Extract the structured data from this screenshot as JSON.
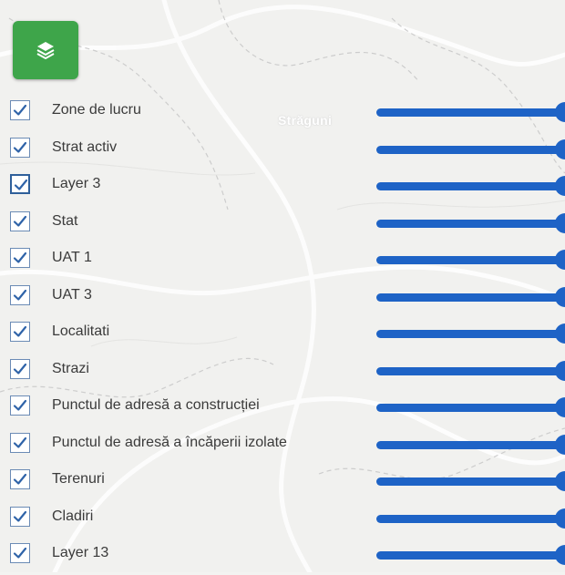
{
  "map": {
    "place_label": "Străguni"
  },
  "layers_button": {
    "icon": "layers-icon",
    "color": "#3ea54a"
  },
  "accent_color": "#1e63c6",
  "layers": [
    {
      "label": "Zone de lucru",
      "checked": true,
      "opacity": 1.0
    },
    {
      "label": "Strat activ",
      "checked": true,
      "opacity": 1.0
    },
    {
      "label": "Layer 3",
      "checked": true,
      "opacity": 1.0,
      "focused": true
    },
    {
      "label": "Stat",
      "checked": true,
      "opacity": 1.0
    },
    {
      "label": "UAT 1",
      "checked": true,
      "opacity": 1.0
    },
    {
      "label": "UAT 3",
      "checked": true,
      "opacity": 1.0
    },
    {
      "label": "Localitati",
      "checked": true,
      "opacity": 1.0
    },
    {
      "label": "Strazi",
      "checked": true,
      "opacity": 1.0
    },
    {
      "label": "Punctul de adresă a construcției",
      "checked": true,
      "opacity": 1.0
    },
    {
      "label": "Punctul de adresă a încăperii izolate",
      "checked": true,
      "opacity": 1.0
    },
    {
      "label": "Terenuri",
      "checked": true,
      "opacity": 1.0
    },
    {
      "label": "Cladiri",
      "checked": true,
      "opacity": 1.0
    },
    {
      "label": "Layer 13",
      "checked": true,
      "opacity": 1.0
    }
  ]
}
